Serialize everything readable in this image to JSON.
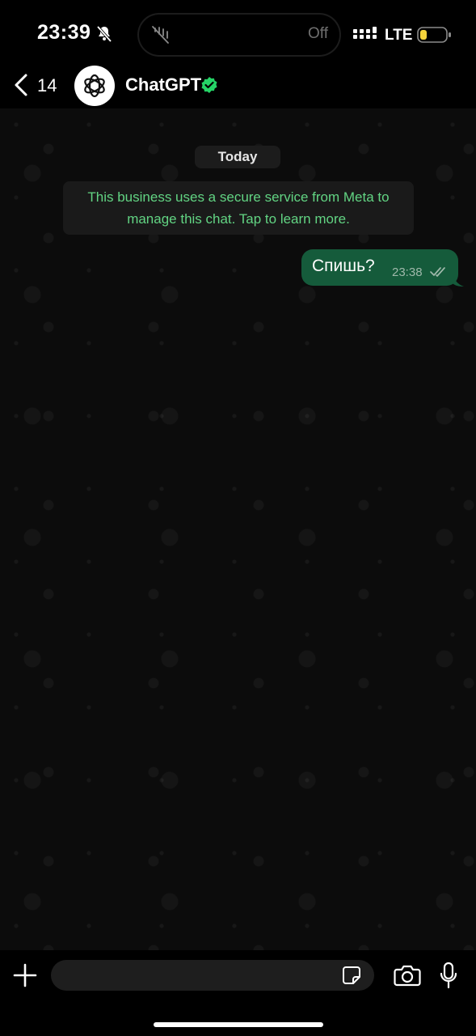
{
  "status_bar": {
    "time": "23:39",
    "island_status": "Off",
    "network": "LTE",
    "battery_color": "#f5d33b"
  },
  "header": {
    "back_count": "14",
    "contact_name": "ChatGPT",
    "verified_color": "#25d366"
  },
  "chat": {
    "date_label": "Today",
    "system_message": "This business uses a secure service from Meta to manage this chat. Tap to learn more.",
    "messages": [
      {
        "text": "Спишь?",
        "time": "23:38",
        "outgoing": true,
        "status": "read"
      }
    ]
  },
  "input_bar": {
    "placeholder": ""
  },
  "icons": {
    "back": "chevron-left-icon",
    "verified": "verified-badge-icon",
    "add": "plus-icon",
    "sticker": "sticker-icon",
    "camera": "camera-icon",
    "mic": "microphone-icon"
  }
}
